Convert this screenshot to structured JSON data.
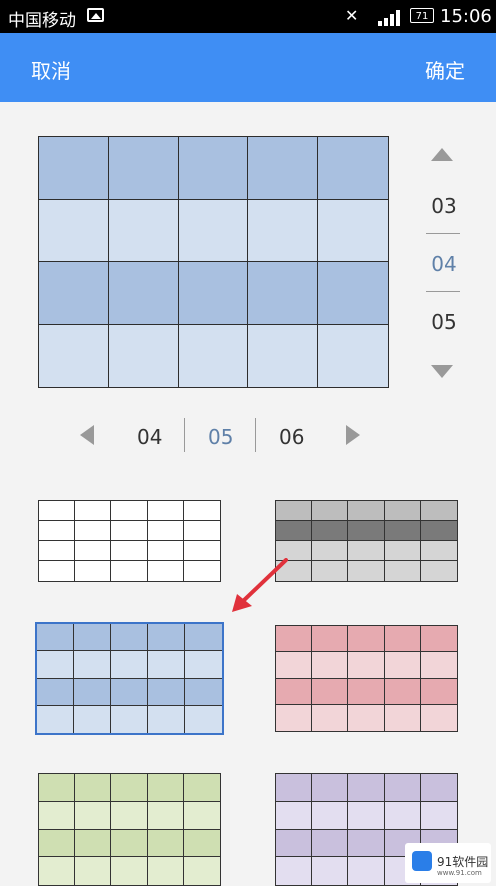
{
  "status_bar": {
    "carrier": "中国移动",
    "time": "15:06",
    "battery": "71"
  },
  "app_bar": {
    "cancel": "取消",
    "confirm": "确定"
  },
  "rows_picker": {
    "values": [
      "03",
      "04",
      "05"
    ],
    "selected": "04"
  },
  "cols_picker": {
    "values": [
      "04",
      "05",
      "06"
    ],
    "selected": "05"
  },
  "styles": [
    {
      "name": "white",
      "header": "#ffffff",
      "band": "#ffffff",
      "light": "#ffffff"
    },
    {
      "name": "gray",
      "header": "#bdbdbd",
      "band": "#7a7a7a",
      "light": "#d5d5d5"
    },
    {
      "name": "blue",
      "header": "#a9c0e0",
      "band": "#a9c0e0",
      "light": "#d3e0f0"
    },
    {
      "name": "red",
      "header": "#e6aab0",
      "band": "#e6aab0",
      "light": "#f2d5d8"
    },
    {
      "name": "green",
      "header": "#cfdfb2",
      "band": "#cfdfb2",
      "light": "#e3edd0"
    },
    {
      "name": "purple",
      "header": "#c9c0dd",
      "band": "#c9c0dd",
      "light": "#e3def0"
    }
  ],
  "watermark": {
    "text": "91软件园",
    "sub": "www.91.com"
  }
}
